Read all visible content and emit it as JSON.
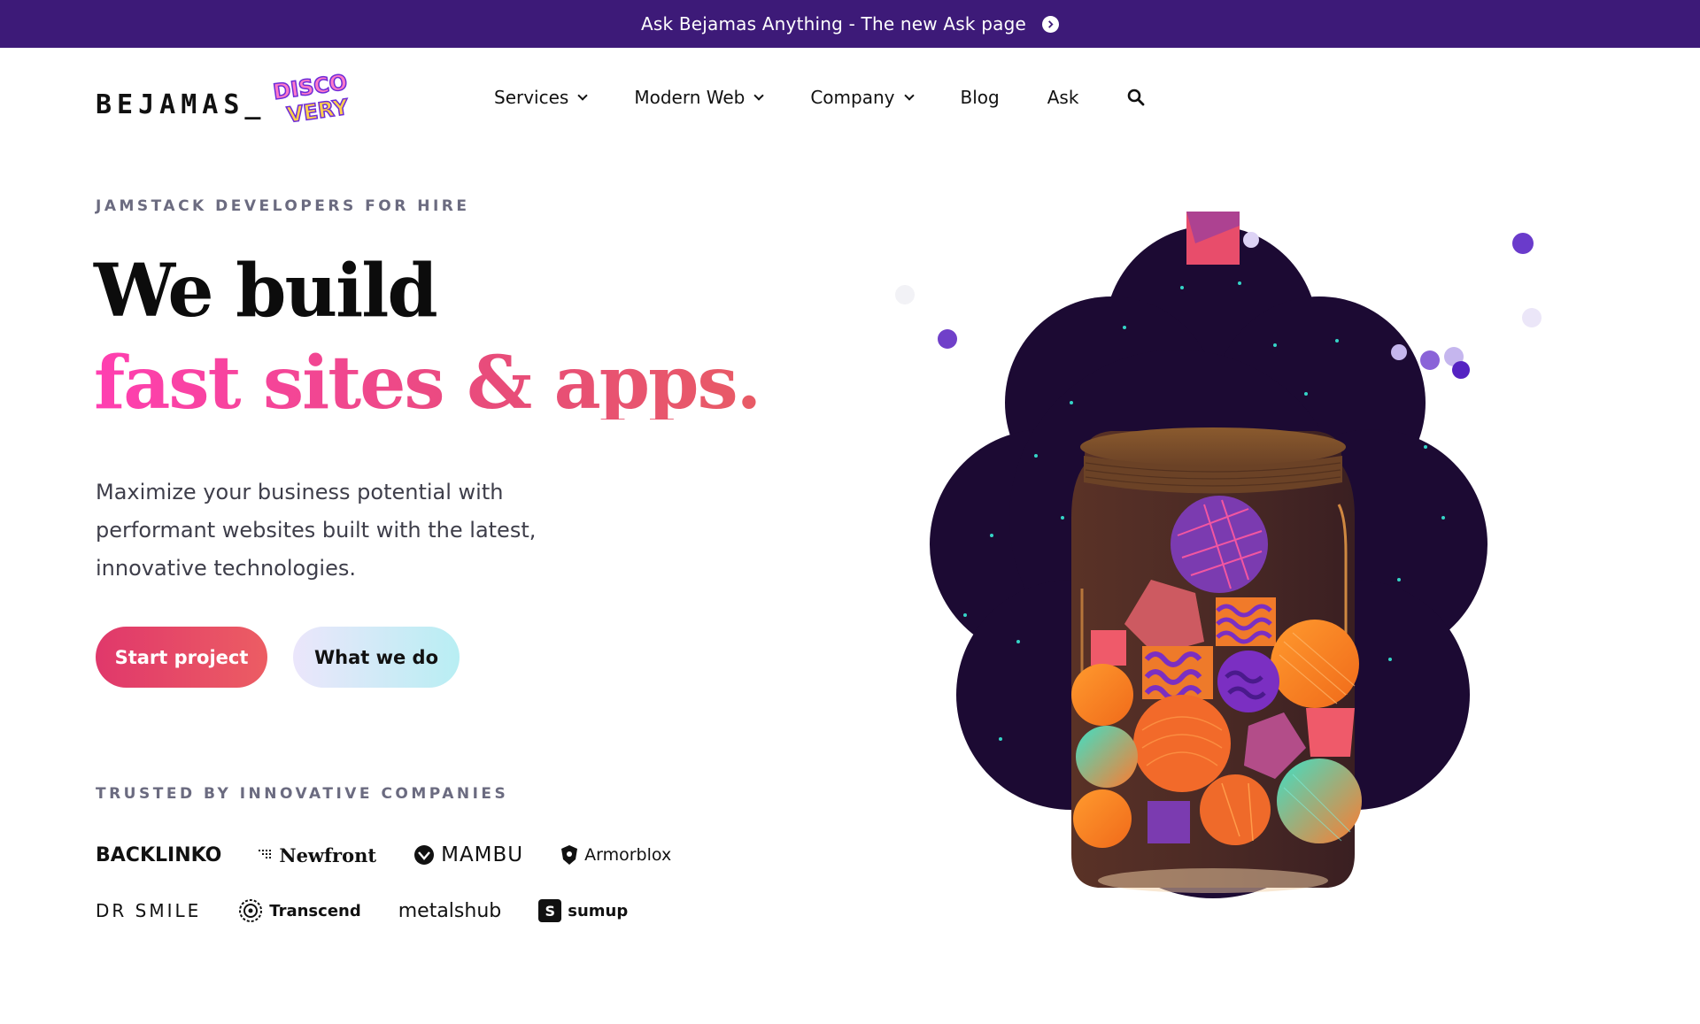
{
  "banner": {
    "text": "Ask Bejamas Anything - The new Ask page"
  },
  "logo": {
    "wordmark": "BEJAMAS_",
    "badge_line1": "DISCO",
    "badge_line2": "VERY"
  },
  "nav": {
    "items": [
      {
        "label": "Services",
        "dropdown": true
      },
      {
        "label": "Modern Web",
        "dropdown": true
      },
      {
        "label": "Company",
        "dropdown": true
      },
      {
        "label": "Blog",
        "dropdown": false
      },
      {
        "label": "Ask",
        "dropdown": false
      }
    ],
    "search_icon": "search-icon"
  },
  "hero": {
    "eyebrow": "JAMSTACK DEVELOPERS FOR HIRE",
    "title_line1": "We build",
    "title_line2": "fast sites & apps.",
    "lead": "Maximize your business potential with performant websites built with the latest, innovative technologies.",
    "primary_button": "Start project",
    "secondary_button": "What we do"
  },
  "trusted": {
    "heading": "TRUSTED BY INNOVATIVE COMPANIES",
    "row1": [
      "BACKLINKO",
      "Newfront",
      "MAMBU",
      "Armorblox"
    ],
    "row2": [
      "DR SMILE",
      "Transcend",
      "metalshub",
      "sumup"
    ]
  },
  "colors": {
    "banner_bg": "#3d1a78",
    "accent_pink": "#ff3fb1",
    "accent_red": "#e0386b",
    "cloud": "#1c0a33"
  }
}
